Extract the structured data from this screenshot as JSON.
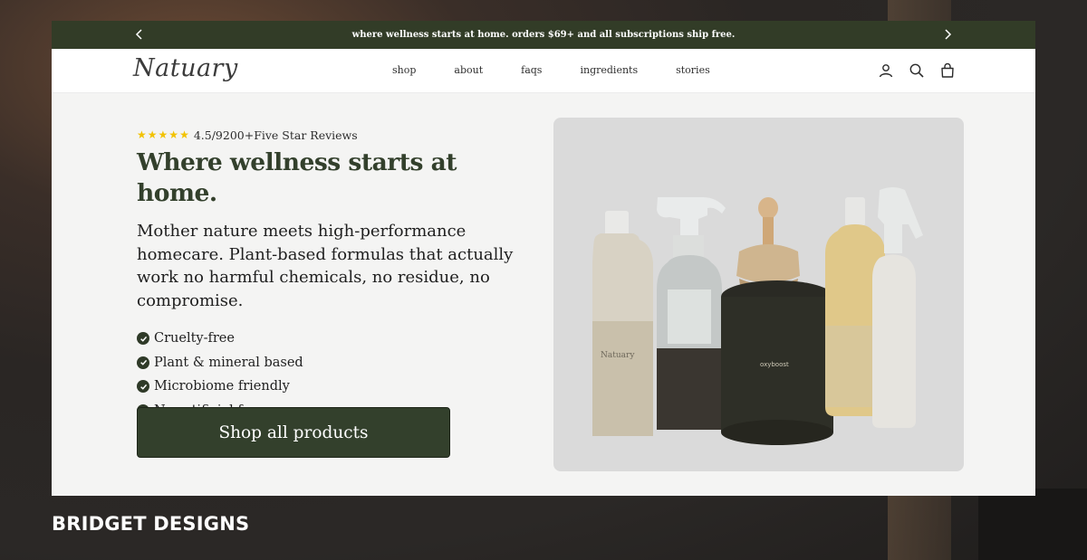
{
  "announcement": {
    "text": "where wellness starts at home. orders $69+ and all subscriptions ship free.",
    "prev_icon": "chevron-left-icon",
    "next_icon": "chevron-right-icon"
  },
  "header": {
    "logo": "Natuary",
    "nav": [
      "shop",
      "about",
      "faqs",
      "ingredients",
      "stories"
    ],
    "icons": [
      "account-icon",
      "search-icon",
      "cart-icon"
    ]
  },
  "hero": {
    "rating_stars": 5,
    "rating_text": "4.5/9200+Five Star Reviews",
    "title": "Where wellness starts at home.",
    "description": "Mother nature meets high-performance homecare. Plant-based formulas that actually work no harmful chemicals, no residue, no compromise.",
    "features": [
      "Cruelty-free",
      "Plant & mineral based",
      "Microbiome friendly",
      "No artificial fragrance"
    ],
    "cta": "Shop all products"
  },
  "product_image": {
    "brand_label": "Natuary",
    "tin_label": "oxyboost"
  },
  "caption": "BRIDGET DESIGNS",
  "colors": {
    "brand_dark_green": "#323c27",
    "star": "#f2c200",
    "hero_bg": "#f4f4f3",
    "card_bg": "#dadada"
  }
}
